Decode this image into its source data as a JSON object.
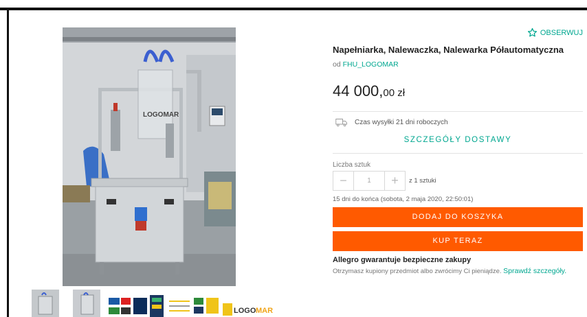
{
  "product": {
    "watch_label": "OBSERWUJ",
    "title": "Napełniarka, Nalewaczka, Nalewarka Półautomatyczna",
    "seller_prefix": "od",
    "seller_name": "FHU_LOGOMAR",
    "price_int": "44 000,",
    "price_dec": "00 zł"
  },
  "delivery": {
    "shipping_text": "Czas wysyłki 21 dni roboczych",
    "details_label": "SZCZEGÓŁY DOSTAWY"
  },
  "purchase": {
    "quantity_label": "Liczba sztuk",
    "quantity_value": "1",
    "minus": "−",
    "plus": "+",
    "quantity_of": "z 1 sztuki",
    "ends_text": "15 dni do końca (sobota, 2 maja 2020, 22:50:01)",
    "add_to_cart": "DODAJ DO KOSZYKA",
    "buy_now": "KUP TERAZ"
  },
  "guarantee": {
    "title": "Allegro gwarantuje bezpieczne zakupy",
    "text": "Otrzymasz kupiony przedmiot albo zwrócimy Ci pieniądze.",
    "link": "Sprawdź szczegóły."
  },
  "gallery": {
    "thumb_logo_text_a": "LOGO",
    "thumb_logo_text_b": "MAR",
    "machine_logo": "LOGOMAR"
  },
  "colors": {
    "accent": "#00a790",
    "button": "#ff5a00"
  }
}
